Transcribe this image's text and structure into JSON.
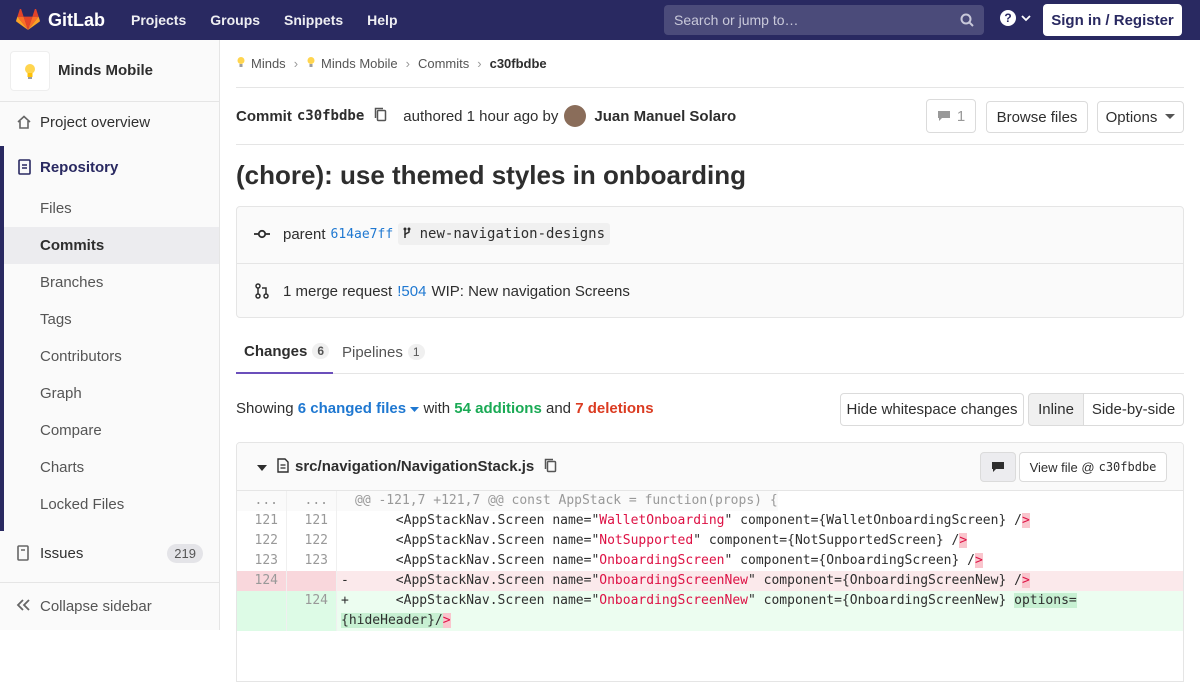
{
  "navbar": {
    "brand": "GitLab",
    "links": [
      "Projects",
      "Groups",
      "Snippets",
      "Help"
    ],
    "search_placeholder": "Search or jump to…",
    "signin": "Sign in / Register"
  },
  "sidebar": {
    "project_name": "Minds Mobile",
    "overview": "Project overview",
    "repository": "Repository",
    "repo_items": [
      "Files",
      "Commits",
      "Branches",
      "Tags",
      "Contributors",
      "Graph",
      "Compare",
      "Charts",
      "Locked Files"
    ],
    "issues": "Issues",
    "issues_count": "219",
    "collapse": "Collapse sidebar"
  },
  "breadcrumb": [
    "Minds",
    "Minds Mobile",
    "Commits",
    "c30fbdbe"
  ],
  "commit": {
    "label": "Commit",
    "sha": "c30fbdbe",
    "authored": "authored 1 hour ago by",
    "author": "Juan Manuel Solaro",
    "comments": "1",
    "browse_files": "Browse files",
    "options": "Options",
    "title": "(chore): use themed styles in onboarding",
    "parent_label": "parent",
    "parent_sha": "614ae7ff",
    "branch": "new-navigation-designs",
    "mr_text": "1 merge request",
    "mr_id": "!504",
    "mr_title": "WIP: New navigation Screens"
  },
  "tabs": [
    {
      "label": "Changes",
      "count": "6"
    },
    {
      "label": "Pipelines",
      "count": "1"
    }
  ],
  "showing": {
    "prefix": "Showing",
    "files": "6 changed files",
    "with": "with",
    "additions": "54 additions",
    "and": "and",
    "deletions": "7 deletions"
  },
  "view_buttons": {
    "hide_ws": "Hide whitespace changes",
    "inline": "Inline",
    "side": "Side-by-side"
  },
  "file": {
    "path": "src/navigation/NavigationStack.js",
    "view_file": "View file @",
    "view_sha": "c30fbdbe"
  },
  "diff": {
    "hunk": "@@ -121,7 +121,7 @@ const AppStack = function(props) {",
    "lines": [
      {
        "old": "121",
        "new": "121",
        "name": "WalletOnboarding",
        "component": "WalletOnboardingScreen"
      },
      {
        "old": "122",
        "new": "122",
        "name": "NotSupported",
        "component": "NotSupportedScreen"
      },
      {
        "old": "123",
        "new": "123",
        "name": "OnboardingScreen",
        "component": "OnboardingScreen"
      }
    ],
    "deleted": {
      "old": "124",
      "name": "OnboardingScreenNew",
      "component": "OnboardingScreenNew"
    },
    "added": {
      "new": "124",
      "name": "OnboardingScreenNew",
      "component": "OnboardingScreenNew",
      "extra": "options=",
      "extra2": "{hideHeader}"
    }
  }
}
